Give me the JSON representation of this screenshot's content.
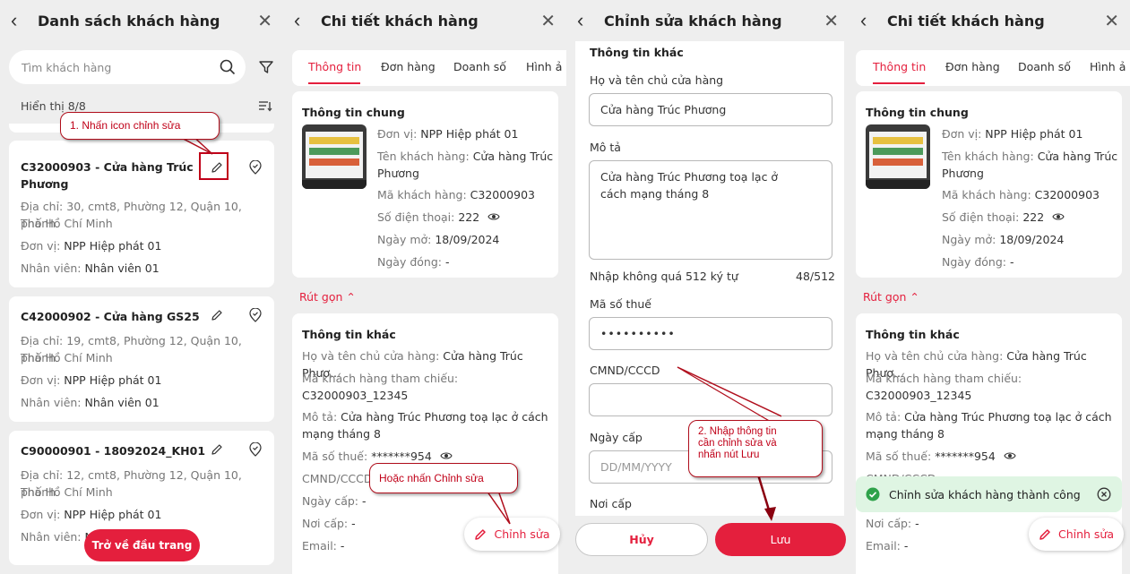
{
  "colors": {
    "accent": "#e41f3d",
    "callout_border": "#b00e1c",
    "success_bg": "#dff5e3",
    "success_icon": "#2ea24a"
  },
  "screen1": {
    "title": "Danh sách khách hàng",
    "search_placeholder": "Tìm khách hàng",
    "showing": "Hiển thị 8/8",
    "callout": "1. Nhấn icon chỉnh sửa",
    "customers": [
      {
        "name_line1": "C32000903 - Cửa hàng Trúc",
        "name_line2": "Phương",
        "addr_line1": "Địa chỉ: 30, cmt8, Phường 12, Quận 10, Thành",
        "addr_line2": "phố Hồ Chí Minh",
        "unit_label": "Đơn vị: ",
        "unit": "NPP Hiệp phát 01",
        "staff_label": "Nhân viên: ",
        "staff": "Nhân viên 01"
      },
      {
        "name_line1": "C42000902 - Cửa hàng GS25",
        "addr_line1": "Địa chỉ: 19, cmt8, Phường 12, Quận 10, Thành",
        "addr_line2": "phố Hồ Chí Minh",
        "unit_label": "Đơn vị: ",
        "unit": "NPP Hiệp phát 01",
        "staff_label": "Nhân viên: ",
        "staff": "Nhân viên 01"
      },
      {
        "name_line1": "C90000901 - 18092024_KH01",
        "addr_line1": "Địa chỉ: 12, cmt8, Phường 12, Quận 10, Thành",
        "addr_line2": "phố Hồ Chí Minh",
        "unit_label": "Đơn vị: ",
        "unit": "NPP Hiệp phát 01",
        "staff_label": "Nhân viên: ",
        "staff": "N"
      }
    ],
    "back_to_top": "Trở về đầu trang"
  },
  "screen2": {
    "title": "Chi tiết khách hàng",
    "tabs": [
      "Thông tin",
      "Đơn hàng",
      "Doanh số",
      "Hình ả"
    ],
    "general_title": "Thông tin chung",
    "general": [
      {
        "label": "Đơn vị: ",
        "value": "NPP Hiệp phát 01"
      },
      {
        "label": "Tên khách hàng: ",
        "value": "Cửa hàng Trúc"
      },
      {
        "label": "",
        "value": "Phương"
      },
      {
        "label": "Mã khách hàng: ",
        "value": "C32000903"
      },
      {
        "label": "Số điện thoại: ",
        "value": "222"
      },
      {
        "label": "Ngày mở: ",
        "value": "18/09/2024"
      },
      {
        "label": "Ngày đóng: ",
        "value": "-"
      }
    ],
    "collapse": "Rút gọn",
    "other_title": "Thông tin khác",
    "other": {
      "owner_label": "Họ và tên chủ cửa hàng: ",
      "owner": "Cửa hàng Trúc Phươ...",
      "ref_label": "Mã khách hàng tham chiếu:",
      "ref": "C32000903_12345",
      "desc_label": "Mô tả: ",
      "desc1": "Cửa hàng Trúc Phương toạ lạc ở cách",
      "desc2": "mạng tháng 8",
      "tax_label": "Mã số thuế: ",
      "tax": "*******954",
      "id_label": "CMND/CCCD",
      "issue_date_label": "Ngày cấp: ",
      "issue_date": "-",
      "issue_place_label": "Nơi cấp: ",
      "issue_place": "-",
      "email_label": "Email: ",
      "email": "-"
    },
    "callout": "Hoặc nhấn Chỉnh sửa",
    "edit_button": "Chỉnh sửa"
  },
  "screen3": {
    "title": "Chỉnh sửa khách hàng",
    "section": "Thông tin khác",
    "owner_label": "Họ và tên chủ cửa hàng",
    "owner_value": "Cửa hàng Trúc Phương",
    "desc_label": "Mô tả",
    "desc_line1": "Cửa hàng Trúc Phương toạ lạc ở",
    "desc_line2": "cách mạng tháng 8",
    "desc_hint": "Nhập không quá 512 ký tự",
    "desc_count": "48/512",
    "tax_label": "Mã số thuế",
    "tax_value": "••••••••••",
    "id_label": "CMND/CCCD",
    "issue_date_label": "Ngày cấp",
    "issue_date_placeholder": "DD/MM/YYYY",
    "issue_place_label": "Nơi cấp",
    "callout_line1": "2. Nhập thông tin",
    "callout_line2": "cần chỉnh sửa và",
    "callout_line3": "nhấn nút Lưu",
    "cancel": "Hủy",
    "save": "Lưu"
  },
  "screen4": {
    "title": "Chi tiết khách hàng",
    "tabs": [
      "Thông tin",
      "Đơn hàng",
      "Doanh số",
      "Hình ả"
    ],
    "general_title": "Thông tin chung",
    "general": [
      {
        "label": "Đơn vị: ",
        "value": "NPP Hiệp phát 01"
      },
      {
        "label": "Tên khách hàng: ",
        "value": "Cửa hàng Trúc"
      },
      {
        "label": "",
        "value": "Phương"
      },
      {
        "label": "Mã khách hàng: ",
        "value": "C32000903"
      },
      {
        "label": "Số điện thoại: ",
        "value": "222"
      },
      {
        "label": "Ngày mở: ",
        "value": "18/09/2024"
      },
      {
        "label": "Ngày đóng: ",
        "value": "-"
      }
    ],
    "collapse": "Rút gọn",
    "other_title": "Thông tin khác",
    "other": {
      "owner_label": "Họ và tên chủ cửa hàng: ",
      "owner": "Cửa hàng Trúc Phươ...",
      "ref_label": "Mã khách hàng tham chiếu:",
      "ref": "C32000903_12345",
      "desc_label": "Mô tả: ",
      "desc1": "Cửa hàng Trúc Phương toạ lạc ở cách",
      "desc2": "mạng tháng 8",
      "tax_label": "Mã số thuế: ",
      "tax": "*******954",
      "id_label": "CMND/CCCD: -",
      "issue_place_label": "Nơi cấp: ",
      "issue_place": "-",
      "email_label": "Email: ",
      "email": "-"
    },
    "toast": "Chỉnh sửa khách hàng thành công",
    "edit_button": "Chỉnh sửa"
  }
}
